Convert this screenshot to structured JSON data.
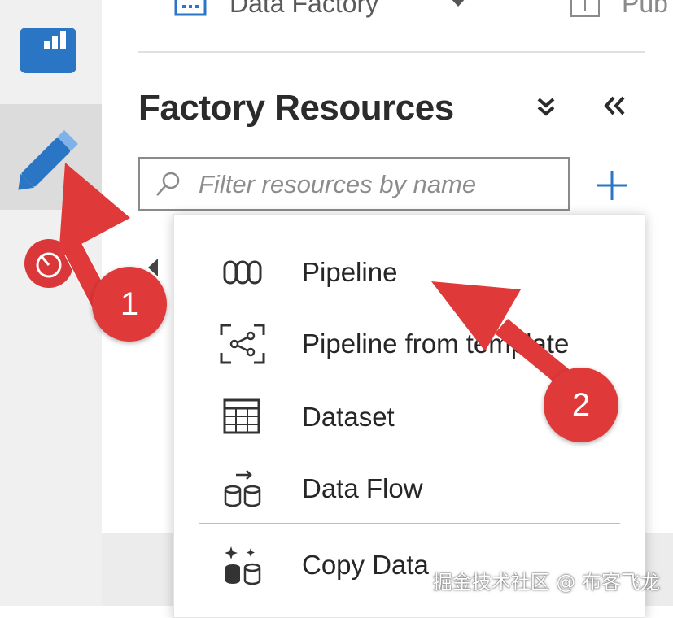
{
  "toolbar": {
    "factory_name": "Data Factory",
    "publish_label": "Pub"
  },
  "panel": {
    "title": "Factory Resources",
    "search_placeholder": "Filter resources by name"
  },
  "menu": {
    "items": [
      {
        "label": "Pipeline",
        "icon": "pipeline-icon"
      },
      {
        "label": "Pipeline from template",
        "icon": "pipeline-template-icon"
      },
      {
        "label": "Dataset",
        "icon": "dataset-icon"
      },
      {
        "label": "Data Flow",
        "icon": "data-flow-icon"
      },
      {
        "label": "Copy Data",
        "icon": "copy-data-icon"
      }
    ]
  },
  "annotations": {
    "badge_1": "1",
    "badge_2": "2",
    "color": "#e0393a"
  },
  "watermark": "掘金技术社区 @ 布客飞龙",
  "colors": {
    "accent": "#2b76c4",
    "arrow": "#e0393a",
    "monitor": "#d9373a"
  }
}
